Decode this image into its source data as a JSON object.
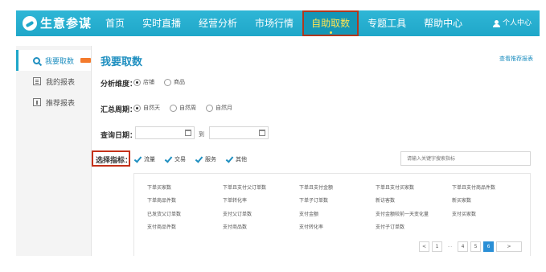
{
  "header": {
    "logo_text": "生意参谋",
    "nav": [
      {
        "label": "首页",
        "active": false
      },
      {
        "label": "实时直播",
        "active": false
      },
      {
        "label": "经营分析",
        "active": false
      },
      {
        "label": "市场行情",
        "active": false
      },
      {
        "label": "自助取数",
        "active": true
      },
      {
        "label": "专题工具",
        "active": false
      },
      {
        "label": "帮助中心",
        "active": false
      }
    ],
    "user_label": "个人中心"
  },
  "sidebar": {
    "items": [
      {
        "label": "我要取数",
        "icon": "search-icon",
        "active": true,
        "badge": "hot"
      },
      {
        "label": "我的报表",
        "icon": "report-icon",
        "active": false
      },
      {
        "label": "推荐报表",
        "icon": "recommend-icon",
        "active": false
      }
    ]
  },
  "main": {
    "title": "我要取数",
    "view_link": "查看推荐报表",
    "dimension": {
      "label": "分析维度：",
      "options": [
        {
          "label": "店铺",
          "selected": true
        },
        {
          "label": "商品",
          "selected": false
        }
      ]
    },
    "period": {
      "label": "汇总周期：",
      "options": [
        {
          "label": "自然天",
          "selected": true
        },
        {
          "label": "自然周",
          "selected": false
        },
        {
          "label": "自然月",
          "selected": false
        }
      ]
    },
    "date": {
      "label": "查询日期：",
      "start_value": "",
      "end_value": "",
      "to_text": "到"
    },
    "metrics": {
      "label": "选择指标：",
      "categories": [
        {
          "label": "流量",
          "checked": true
        },
        {
          "label": "交易",
          "checked": true
        },
        {
          "label": "服务",
          "checked": true
        },
        {
          "label": "其他",
          "checked": true
        }
      ],
      "search_placeholder": "请输入关键字搜索指标",
      "items": [
        "下单买家数",
        "下单且支付父订单数",
        "下单且支付金额",
        "下单且支付买家数",
        "下单且支付商品件数",
        "下单商品件数",
        "下单转化率",
        "下单子订单数",
        "新访客数",
        "新买家数",
        "已发货父订单数",
        "支付父订单数",
        "支付金额",
        "支付金额较前一天变化量",
        "支付买家数",
        "支付商品件数",
        "支付商品数",
        "支付转化率",
        "支付子订单数"
      ]
    },
    "pagination": {
      "prev": "<",
      "pages": [
        "1",
        "...",
        "4",
        "5",
        "6"
      ],
      "current": "6",
      "next": ">"
    }
  },
  "colors": {
    "header_bg": "#1fa7c9",
    "active_nav_text": "#ffe552",
    "accent": "#1f8fc0",
    "highlight_border": "#c4321a",
    "page_active": "#2a8fd6"
  }
}
